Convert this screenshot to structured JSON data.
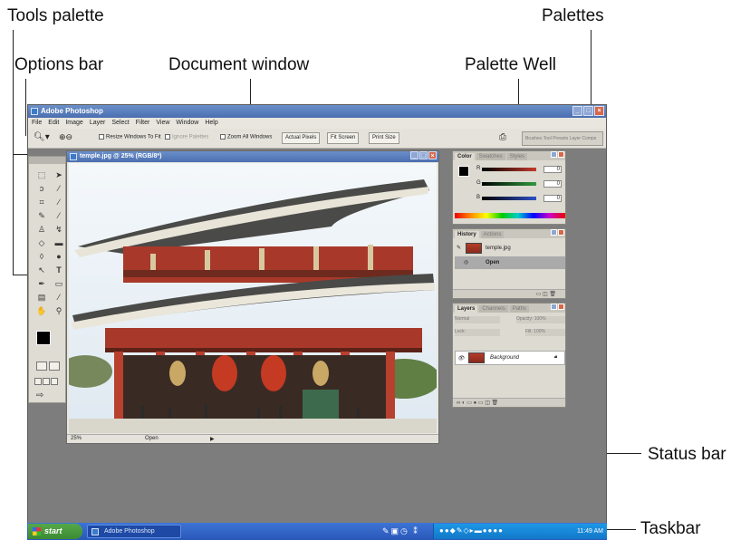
{
  "callouts": {
    "tools_palette": "Tools palette",
    "options_bar": "Options bar",
    "document_window": "Document window",
    "palettes": "Palettes",
    "palette_well": "Palette Well",
    "status_bar": "Status bar",
    "taskbar": "Taskbar"
  },
  "app": {
    "title": "Adobe Photoshop",
    "menu": [
      "File",
      "Edit",
      "Image",
      "Layer",
      "Select",
      "Filter",
      "View",
      "Window",
      "Help"
    ]
  },
  "options_bar": {
    "zoom_tool_icon": "magnifier-icon",
    "resize_windows": "Resize Windows To Fit",
    "ignore_palettes": "Ignore Palettes",
    "zoom_all_windows": "Zoom All Windows",
    "actual_pixels": "Actual Pixels",
    "fit_screen": "Fit Screen",
    "print_size": "Print Size",
    "palette_well_tabs": "Brushes  Tool Presets  Layer Comps"
  },
  "document": {
    "title": "temple.jpg @ 25% (RGB/8*)",
    "zoom": "25%",
    "status": "Open"
  },
  "color_palette": {
    "tabs": [
      "Color",
      "Swatches",
      "Styles"
    ],
    "channels": [
      {
        "label": "R",
        "value": "0",
        "color": "#c43a2e"
      },
      {
        "label": "G",
        "value": "0",
        "color": "#2e9a3c"
      },
      {
        "label": "B",
        "value": "0",
        "color": "#2e4ec4"
      }
    ]
  },
  "history_palette": {
    "tabs": [
      "History",
      "Actions"
    ],
    "snapshot": "temple.jpg",
    "state": "Open"
  },
  "layers_palette": {
    "tabs": [
      "Layers",
      "Channels",
      "Paths"
    ],
    "blend_mode": "Normal",
    "opacity": "Opacity: 100%",
    "lock": "Lock:",
    "fill": "Fill: 100%",
    "layer_name": "Background"
  },
  "taskbar": {
    "start": "start",
    "app_button": "Adobe Photoshop",
    "clock": "11:49 AM"
  },
  "colors": {
    "title_blue": "#4b6fb0",
    "workspace_gray": "#7d7d7d",
    "taskbar_blue": "#2a57b8",
    "start_green": "#3b8a33"
  }
}
